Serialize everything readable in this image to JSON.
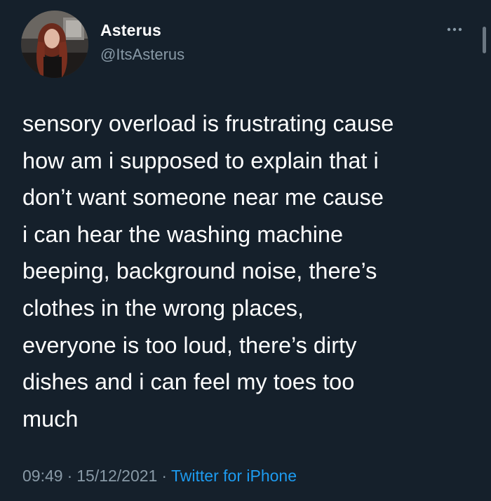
{
  "author": {
    "display_name": "Asterus",
    "handle": "@ItsAsterus",
    "avatar_icon": "profile-photo"
  },
  "tweet": {
    "text_lines": [
      "sensory overload is frustrating cause",
      "how am i supposed to explain that i",
      "don’t want someone near me cause",
      "i can hear the washing machine",
      "beeping, background noise, there’s",
      "clothes in the wrong places,",
      "everyone is too loud, there’s dirty",
      "dishes and i can feel my toes too",
      "much"
    ]
  },
  "meta": {
    "time": "09:49",
    "separator": "·",
    "date": "15/12/2021",
    "source": "Twitter for iPhone"
  },
  "colors": {
    "background": "#15202b",
    "text": "#ffffff",
    "secondary": "#8899a6",
    "link": "#1d9bf0"
  },
  "icons": {
    "more": "more-options-icon"
  }
}
